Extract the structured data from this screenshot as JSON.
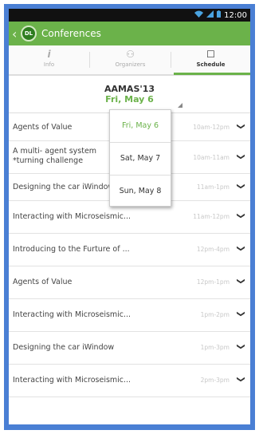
{
  "status_bar": {
    "time": "12:00",
    "wifi_icon": "wifi-icon",
    "signal_icon": "signal-icon",
    "battery_icon": "battery-icon"
  },
  "action_bar": {
    "back_icon": "back-chevron-icon",
    "logo_text": "DL",
    "title": "Conferences"
  },
  "tabs": [
    {
      "label": "Info",
      "icon": "info-icon",
      "glyph": "i",
      "active": false
    },
    {
      "label": "Organizers",
      "icon": "people-icon",
      "glyph": "⚇",
      "active": false
    },
    {
      "label": "Schedule",
      "icon": "schedule-icon",
      "glyph": "☐",
      "active": true
    }
  ],
  "conference": {
    "name": "AAMAS'13",
    "date": "Fri, May 6"
  },
  "dropdown": {
    "options": [
      "Fri, May 6",
      "Sat, May 7",
      "Sun, May 8"
    ],
    "selected": "Fri, May 6"
  },
  "sessions": [
    {
      "title": "Agents of Value",
      "time": "10am-12pm"
    },
    {
      "title": "A multi- agent system",
      "title_line2": "*turning challenge",
      "time": "10am-11am"
    },
    {
      "title": "Designing the car iWindow",
      "time": "11am-1pm"
    },
    {
      "title": "Interacting with Microseismic...",
      "time": "11am-12pm"
    },
    {
      "title": "Introducing to the Furture of ...",
      "time": "12pm-4pm"
    },
    {
      "title": "Agents of Value",
      "time": "12pm-1pm"
    },
    {
      "title": "Interacting with Microseismic...",
      "time": "1pm-2pm"
    },
    {
      "title": "Designing the car iWindow",
      "time": "1pm-3pm"
    },
    {
      "title": "Interacting with Microseismic...",
      "time": "2pm-3pm"
    }
  ],
  "colors": {
    "accent": "#6bb24a",
    "frame": "#4a7fd4",
    "status_bar": "#111111"
  }
}
